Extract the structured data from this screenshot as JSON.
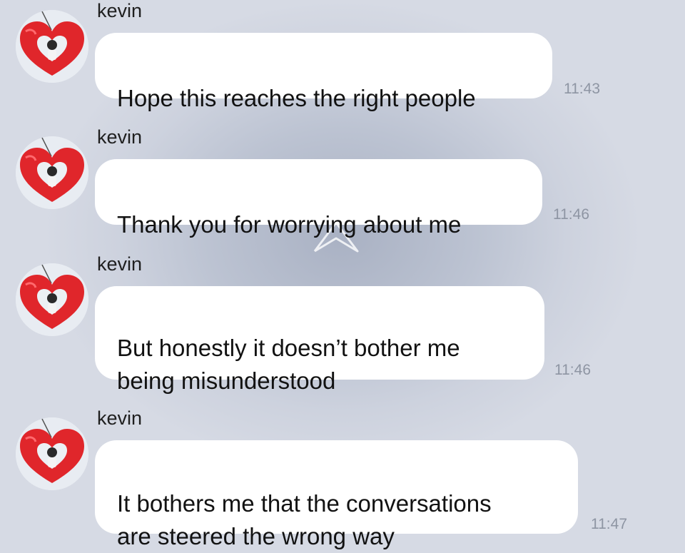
{
  "chat": {
    "messages": [
      {
        "sender": "kevin",
        "text": "Hope this reaches the right people",
        "time": "11:43"
      },
      {
        "sender": "kevin",
        "text": "Thank you for worrying about me",
        "time": "11:46"
      },
      {
        "sender": "kevin",
        "text": "But honestly it doesn’t bother me\nbeing misunderstood",
        "time": "11:46"
      },
      {
        "sender": "kevin",
        "text": "It bothers me that the conversations\nare steered the wrong way",
        "time": "11:47"
      }
    ]
  },
  "colors": {
    "bubble": "#ffffff",
    "heart_balloon": "#e0262b",
    "timestamp": "#8e95a3"
  },
  "icons": {
    "avatar": "heart-balloon-avatar-icon",
    "watermark": "star-watermark-icon"
  }
}
